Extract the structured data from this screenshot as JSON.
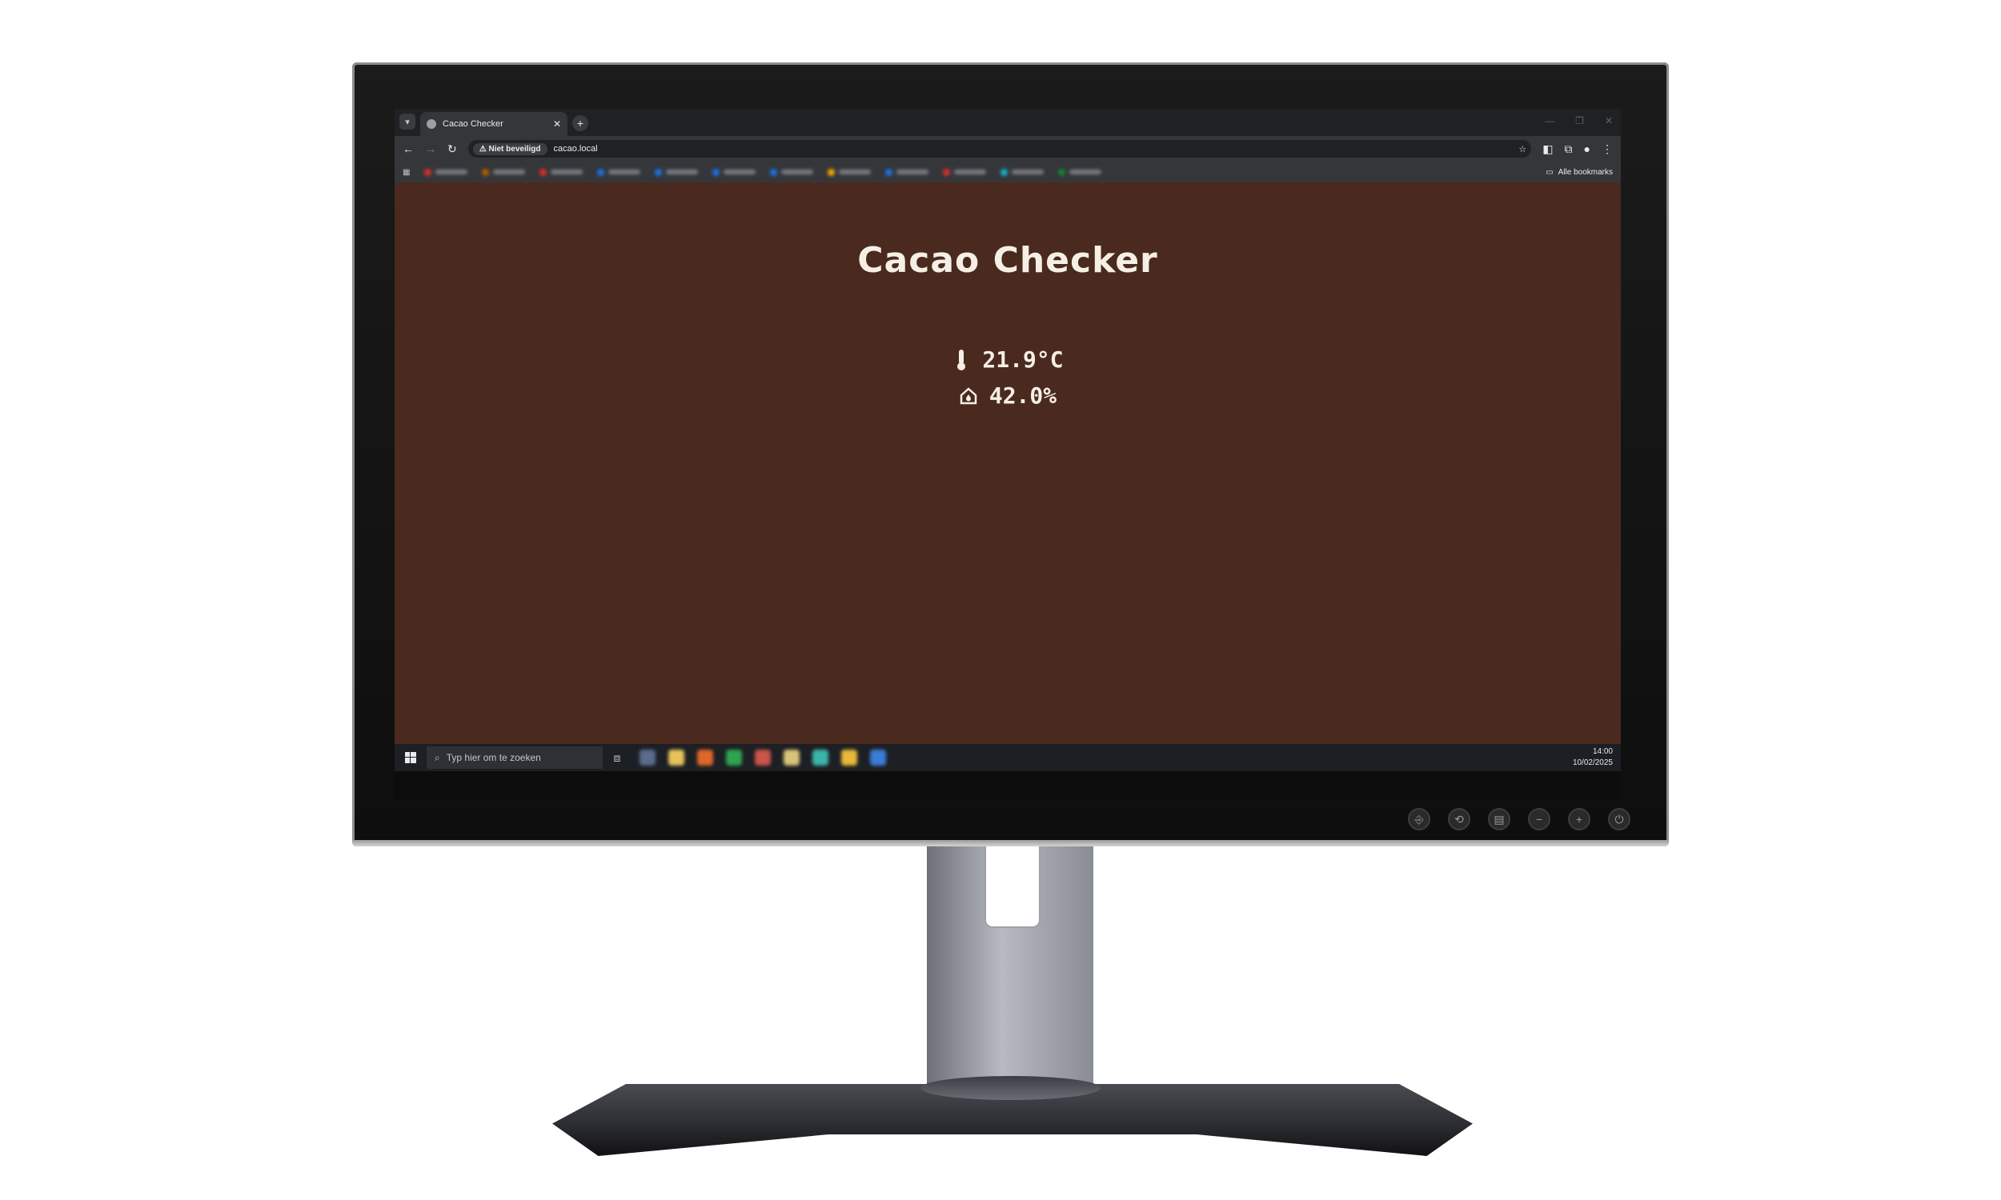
{
  "browser": {
    "tab_title": "Cacao Checker",
    "security_label": "Niet beveiligd",
    "url": "cacao.local",
    "all_bookmarks_label": "Alle bookmarks"
  },
  "page": {
    "title": "Cacao Checker",
    "temperature": "21.9°C",
    "humidity": "42.0%"
  },
  "taskbar": {
    "search_placeholder": "Typ hier om te zoeken",
    "time": "14:00",
    "date": "10/02/2025"
  },
  "colors": {
    "page_background": "#4a2a1e",
    "text": "#f6efe6"
  },
  "icons": {
    "temperature": "thermometer-icon",
    "humidity": "home-humidity-icon"
  }
}
